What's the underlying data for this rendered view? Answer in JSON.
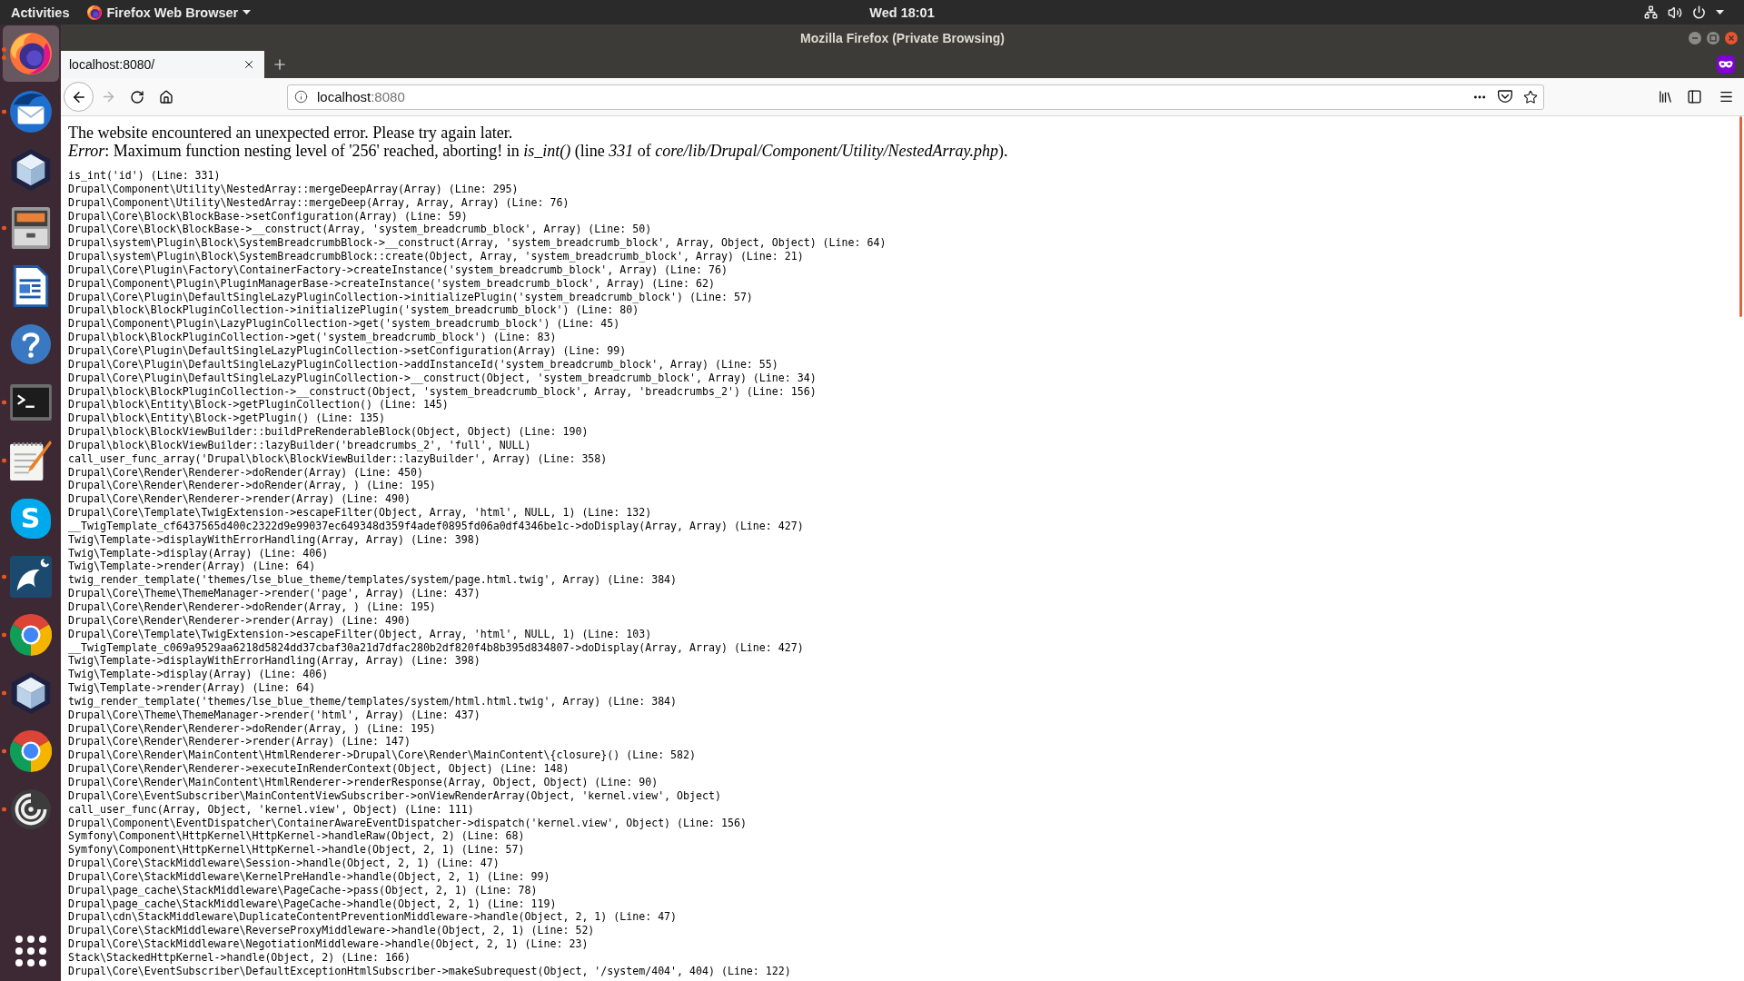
{
  "top_bar": {
    "activities": "Activities",
    "app_menu": "Firefox Web Browser",
    "clock": "Wed 18:01"
  },
  "dock": {
    "items": [
      {
        "kind": "fox",
        "selected": true,
        "running": true,
        "two_windows": true
      },
      {
        "kind": "mail",
        "selected": false,
        "running": true,
        "two_windows": false
      },
      {
        "kind": "cube",
        "selected": false,
        "running": false,
        "two_windows": false
      },
      {
        "kind": "cabinet",
        "selected": false,
        "running": true,
        "two_windows": false
      },
      {
        "kind": "writer",
        "selected": false,
        "running": false,
        "two_windows": false
      },
      {
        "kind": "help",
        "selected": false,
        "running": false,
        "two_windows": false
      },
      {
        "kind": "terminal",
        "selected": false,
        "running": true,
        "two_windows": false
      },
      {
        "kind": "notepad",
        "selected": false,
        "running": true,
        "two_windows": false
      },
      {
        "kind": "letter",
        "glyph": "S",
        "selected": false,
        "running": false,
        "two_windows": false
      },
      {
        "kind": "dolphin",
        "selected": false,
        "running": true,
        "two_windows": false
      },
      {
        "kind": "ring",
        "selected": false,
        "running": true,
        "two_windows": false
      },
      {
        "kind": "cube",
        "selected": false,
        "running": true,
        "two_windows": false
      },
      {
        "kind": "ring",
        "selected": false,
        "running": true,
        "two_windows": false
      },
      {
        "kind": "spiral",
        "selected": false,
        "running": true,
        "two_windows": false
      }
    ]
  },
  "window": {
    "title": "Mozilla Firefox (Private Browsing)"
  },
  "tabs": [
    {
      "label": "localhost:8080/",
      "selected": true
    }
  ],
  "toolbar": {
    "back": {
      "disabled": false
    },
    "forward": {
      "disabled": true
    }
  },
  "url_bar": {
    "host": "localhost",
    "port": ":8080"
  },
  "page": {
    "message": "The website encountered an unexpected error. Please try again later.",
    "error": "*Error*: Maximum function nesting level of '256' reached, aborting! in *is_int()* (line *331* of *core/lib/Drupal/Component/Utility/NestedArray.php*).",
    "backtrace": [
      "is_int('id') (Line: 331)",
      "Drupal\\Component\\Utility\\NestedArray::mergeDeepArray(Array) (Line: 295)",
      "Drupal\\Component\\Utility\\NestedArray::mergeDeep(Array, Array, Array) (Line: 76)",
      "Drupal\\Core\\Block\\BlockBase->setConfiguration(Array) (Line: 59)",
      "Drupal\\Core\\Block\\BlockBase->__construct(Array, 'system_breadcrumb_block', Array) (Line: 50)",
      "Drupal\\system\\Plugin\\Block\\SystemBreadcrumbBlock->__construct(Array, 'system_breadcrumb_block', Array, Object, Object) (Line: 64)",
      "Drupal\\system\\Plugin\\Block\\SystemBreadcrumbBlock::create(Object, Array, 'system_breadcrumb_block', Array) (Line: 21)",
      "Drupal\\Core\\Plugin\\Factory\\ContainerFactory->createInstance('system_breadcrumb_block', Array) (Line: 76)",
      "Drupal\\Component\\Plugin\\PluginManagerBase->createInstance('system_breadcrumb_block', Array) (Line: 62)",
      "Drupal\\Core\\Plugin\\DefaultSingleLazyPluginCollection->initializePlugin('system_breadcrumb_block') (Line: 57)",
      "Drupal\\block\\BlockPluginCollection->initializePlugin('system_breadcrumb_block') (Line: 80)",
      "Drupal\\Component\\Plugin\\LazyPluginCollection->get('system_breadcrumb_block') (Line: 45)",
      "Drupal\\block\\BlockPluginCollection->get('system_breadcrumb_block') (Line: 83)",
      "Drupal\\Core\\Plugin\\DefaultSingleLazyPluginCollection->setConfiguration(Array) (Line: 99)",
      "Drupal\\Core\\Plugin\\DefaultSingleLazyPluginCollection->addInstanceId('system_breadcrumb_block', Array) (Line: 55)",
      "Drupal\\Core\\Plugin\\DefaultSingleLazyPluginCollection->__construct(Object, 'system_breadcrumb_block', Array) (Line: 34)",
      "Drupal\\block\\BlockPluginCollection->__construct(Object, 'system_breadcrumb_block', Array, 'breadcrumbs_2') (Line: 156)",
      "Drupal\\block\\Entity\\Block->getPluginCollection() (Line: 145)",
      "Drupal\\block\\Entity\\Block->getPlugin() (Line: 135)",
      "Drupal\\block\\BlockViewBuilder::buildPreRenderableBlock(Object, Object) (Line: 190)",
      "Drupal\\block\\BlockViewBuilder::lazyBuilder('breadcrumbs_2', 'full', NULL)",
      "call_user_func_array('Drupal\\block\\BlockViewBuilder::lazyBuilder', Array) (Line: 358)",
      "Drupal\\Core\\Render\\Renderer->doRender(Array) (Line: 450)",
      "Drupal\\Core\\Render\\Renderer->doRender(Array, ) (Line: 195)",
      "Drupal\\Core\\Render\\Renderer->render(Array) (Line: 490)",
      "Drupal\\Core\\Template\\TwigExtension->escapeFilter(Object, Array, 'html', NULL, 1) (Line: 132)",
      "__TwigTemplate_cf6437565d400c2322d9e99037ec649348d359f4adef0895fd06a0df4346be1c->doDisplay(Array, Array) (Line: 427)",
      "Twig\\Template->displayWithErrorHandling(Array, Array) (Line: 398)",
      "Twig\\Template->display(Array) (Line: 406)",
      "Twig\\Template->render(Array) (Line: 64)",
      "twig_render_template('themes/lse_blue_theme/templates/system/page.html.twig', Array) (Line: 384)",
      "Drupal\\Core\\Theme\\ThemeManager->render('page', Array) (Line: 437)",
      "Drupal\\Core\\Render\\Renderer->doRender(Array, ) (Line: 195)",
      "Drupal\\Core\\Render\\Renderer->render(Array) (Line: 490)",
      "Drupal\\Core\\Template\\TwigExtension->escapeFilter(Object, Array, 'html', NULL, 1) (Line: 103)",
      "__TwigTemplate_c069a9529aa6218d5824dd37cbaf30a21d7dfac280b2df820f4b8b395d834807->doDisplay(Array, Array) (Line: 427)",
      "Twig\\Template->displayWithErrorHandling(Array, Array) (Line: 398)",
      "Twig\\Template->display(Array) (Line: 406)",
      "Twig\\Template->render(Array) (Line: 64)",
      "twig_render_template('themes/lse_blue_theme/templates/system/html.html.twig', Array) (Line: 384)",
      "Drupal\\Core\\Theme\\ThemeManager->render('html', Array) (Line: 437)",
      "Drupal\\Core\\Render\\Renderer->doRender(Array, ) (Line: 195)",
      "Drupal\\Core\\Render\\Renderer->render(Array) (Line: 147)",
      "Drupal\\Core\\Render\\MainContent\\HtmlRenderer->Drupal\\Core\\Render\\MainContent\\{closure}() (Line: 582)",
      "Drupal\\Core\\Render\\Renderer->executeInRenderContext(Object, Object) (Line: 148)",
      "Drupal\\Core\\Render\\MainContent\\HtmlRenderer->renderResponse(Array, Object, Object) (Line: 90)",
      "Drupal\\Core\\EventSubscriber\\MainContentViewSubscriber->onViewRenderArray(Object, 'kernel.view', Object)",
      "call_user_func(Array, Object, 'kernel.view', Object) (Line: 111)",
      "Drupal\\Component\\EventDispatcher\\ContainerAwareEventDispatcher->dispatch('kernel.view', Object) (Line: 156)",
      "Symfony\\Component\\HttpKernel\\HttpKernel->handleRaw(Object, 2) (Line: 68)",
      "Symfony\\Component\\HttpKernel\\HttpKernel->handle(Object, 2, 1) (Line: 57)",
      "Drupal\\Core\\StackMiddleware\\Session->handle(Object, 2, 1) (Line: 47)",
      "Drupal\\Core\\StackMiddleware\\KernelPreHandle->handle(Object, 2, 1) (Line: 99)",
      "Drupal\\page_cache\\StackMiddleware\\PageCache->pass(Object, 2, 1) (Line: 78)",
      "Drupal\\page_cache\\StackMiddleware\\PageCache->handle(Object, 2, 1) (Line: 119)",
      "Drupal\\cdn\\StackMiddleware\\DuplicateContentPreventionMiddleware->handle(Object, 2, 1) (Line: 47)",
      "Drupal\\Core\\StackMiddleware\\ReverseProxyMiddleware->handle(Object, 2, 1) (Line: 52)",
      "Drupal\\Core\\StackMiddleware\\NegotiationMiddleware->handle(Object, 2, 1) (Line: 23)",
      "Stack\\StackedHttpKernel->handle(Object, 2) (Line: 166)",
      "Drupal\\Core\\EventSubscriber\\DefaultExceptionHtmlSubscriber->makeSubrequest(Object, '/system/404', 404) (Line: 122)"
    ]
  }
}
